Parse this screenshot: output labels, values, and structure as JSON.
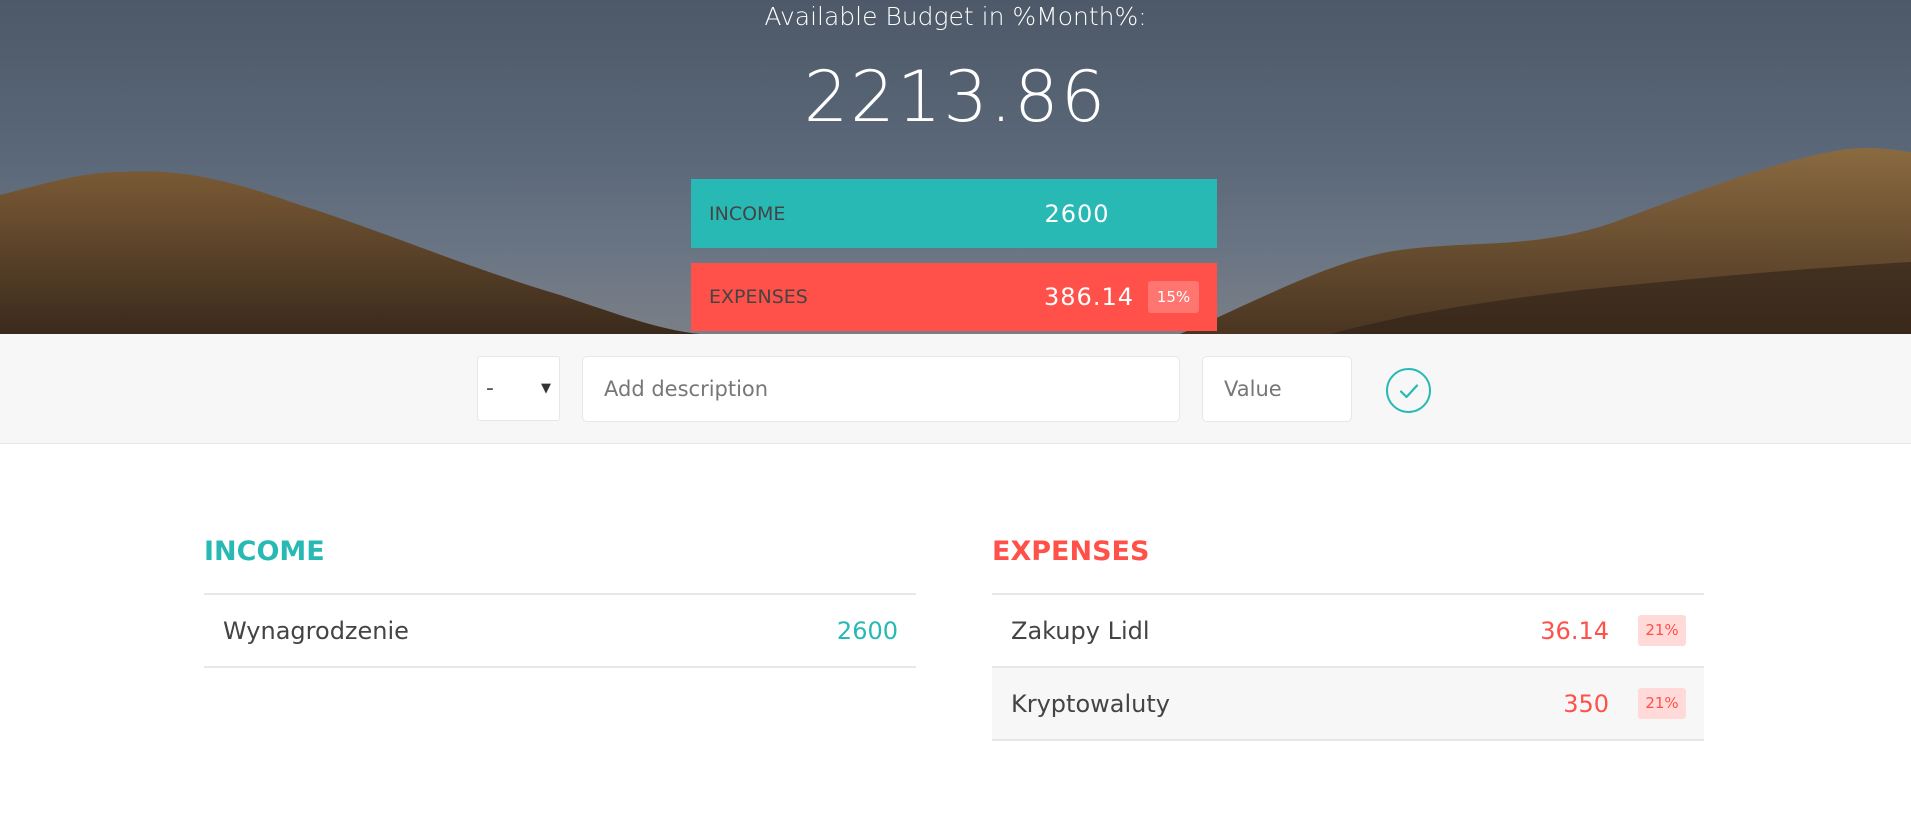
{
  "header": {
    "budget_title": "Available Budget in %Month%:",
    "budget_value": "2213.86",
    "income_label": "Income",
    "income_value": "2600",
    "expenses_label": "Expenses",
    "expenses_value": "386.14",
    "expenses_percentage": "15%"
  },
  "add_form": {
    "type_selected": "-",
    "description_placeholder": "Add description",
    "value_placeholder": "Value"
  },
  "income": {
    "title": "Income",
    "items": [
      {
        "description": "Wynagrodzenie",
        "value": "2600"
      }
    ]
  },
  "expenses": {
    "title": "Expenses",
    "items": [
      {
        "description": "Zakupy Lidl",
        "value": "36.14",
        "percentage": "21%"
      },
      {
        "description": "Kryptowaluty",
        "value": "350",
        "percentage": "21%"
      }
    ]
  },
  "colors": {
    "income": "#28b9b5",
    "expenses": "#ff5049"
  },
  "icons": {
    "add_button": "checkmark-circle-icon",
    "type_select": "caret-down-icon"
  }
}
